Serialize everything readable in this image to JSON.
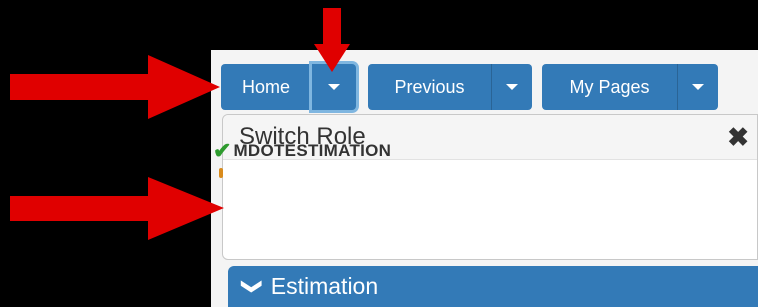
{
  "toolbar": {
    "home_label": "Home",
    "previous_label": "Previous",
    "mypages_label": "My Pages"
  },
  "switch_role": {
    "title": "Switch Role",
    "close_glyph": "✖",
    "check_glyph": "✔",
    "role": "MDOTESTIMATION"
  },
  "section": {
    "label": "Estimation",
    "chevron_glyph": "❯"
  },
  "colors": {
    "button_blue": "#337ab7",
    "arrow_red": "#e00000",
    "check_green": "#2e9b2e"
  }
}
